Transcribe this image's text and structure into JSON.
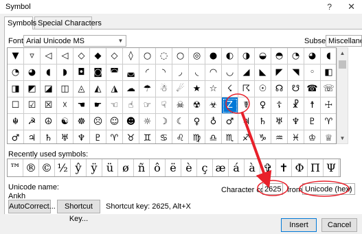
{
  "window": {
    "title": "Symbol",
    "help_icon": "?",
    "close_icon": "✕"
  },
  "tabs": [
    {
      "label": "Symbols",
      "active": true
    },
    {
      "label": "Special Characters",
      "active": false
    }
  ],
  "font": {
    "label": "Font:",
    "value": "Arial Unicode MS"
  },
  "subset": {
    "label": "Subset:",
    "value": "Miscellaneous Symbols"
  },
  "grid": {
    "selected_char": "♀",
    "rows": [
      [
        "▼",
        "▿",
        "◁",
        "◁",
        "◇",
        "◆",
        "◇",
        "◊",
        "○",
        "◌",
        "○",
        "◎",
        "●",
        "◐",
        "◑",
        "◒",
        "◓",
        "◔",
        "◕",
        "◖"
      ],
      [
        "◔",
        "◕",
        "◖",
        "◗",
        "◘",
        "◙",
        "◚",
        "◛",
        "◜",
        "◝",
        "◞",
        "◟",
        "◠",
        "◡",
        "◢",
        "◣",
        "◤",
        "◥",
        "◦",
        "◧"
      ],
      [
        "◨",
        "◩",
        "◪",
        "◫",
        "◬",
        "◭",
        "◮",
        "☁",
        "☂",
        "☃",
        "☄",
        "★",
        "☆",
        "☇",
        "☈",
        "☉",
        "☊",
        "☋",
        "☎",
        "☏"
      ],
      [
        "☐",
        "☑",
        "☒",
        "☓",
        "☚",
        "☛",
        "☜",
        "☝",
        "☞",
        "☟",
        "☠",
        "☢",
        "☣",
        "Z",
        "☤",
        "♀",
        "☦",
        "☧",
        "☨",
        "☩"
      ],
      [
        "☬",
        "☭",
        "☮",
        "☯",
        "☸",
        "☹",
        "☺",
        "☻",
        "☼",
        "☽",
        "☾",
        "♀",
        "♁",
        "♂",
        "♃",
        "♄",
        "♅",
        "♆",
        "♇",
        "♈"
      ],
      [
        "♂",
        "♃",
        "♄",
        "♅",
        "♆",
        "♇",
        "♈",
        "♉",
        "♊",
        "♋",
        "♌",
        "♍",
        "♎",
        "♏",
        "♐",
        "♑",
        "♒",
        "♓",
        "♔",
        "♕"
      ]
    ]
  },
  "recent": {
    "label": "Recently used symbols:",
    "items": [
      "™",
      "®",
      "©",
      "½",
      "ŷ",
      "ÿ",
      "ü",
      "ø",
      "ñ",
      "ô",
      "ë",
      "è",
      "ç",
      "æ",
      "á",
      "à",
      "✞",
      "✝",
      "Φ",
      "Π",
      "Ψ"
    ]
  },
  "unicode_name": {
    "label": "Unicode name:",
    "value": "Ankh"
  },
  "character_code": {
    "label": "Character code:",
    "value": "2625"
  },
  "from": {
    "label": "from:",
    "value": "Unicode (hex)"
  },
  "buttons": {
    "autocorrect": "AutoCorrect...",
    "shortcut_key": "Shortcut Key...",
    "insert": "Insert",
    "cancel": "Cancel"
  },
  "shortcut_key_text": "Shortcut key: 2625, Alt+X",
  "annotation_color": "#e8202a",
  "selection_color": "#0078d7"
}
